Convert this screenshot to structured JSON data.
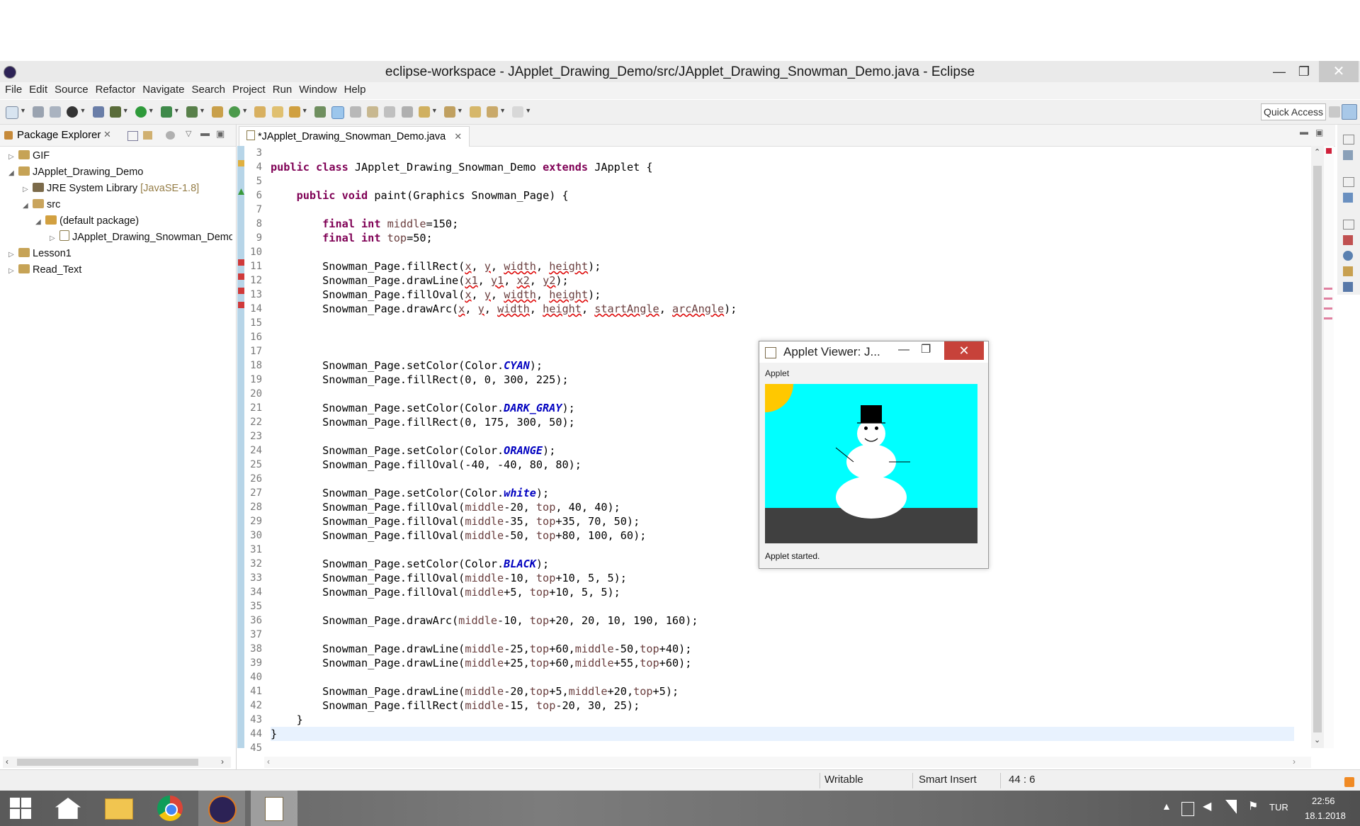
{
  "window": {
    "title": "eclipse-workspace - JApplet_Drawing_Demo/src/JApplet_Drawing_Snowman_Demo.java - Eclipse"
  },
  "menu": [
    "File",
    "Edit",
    "Source",
    "Refactor",
    "Navigate",
    "Search",
    "Project",
    "Run",
    "Window",
    "Help"
  ],
  "toolbar": {
    "quick_access": "Quick Access"
  },
  "package_explorer": {
    "tab_label": "Package Explorer",
    "items": [
      {
        "label": "GIF"
      },
      {
        "label": "JApplet_Drawing_Demo"
      },
      {
        "label": "JRE System Library",
        "decoration": "[JavaSE-1.8]"
      },
      {
        "label": "src"
      },
      {
        "label": "(default package)"
      },
      {
        "label": "JApplet_Drawing_Snowman_Demo"
      },
      {
        "label": "Lesson1"
      },
      {
        "label": "Read_Text"
      }
    ]
  },
  "editor": {
    "tab_label": "*JApplet_Drawing_Snowman_Demo.java",
    "line_numbers": [
      "3",
      "4",
      "5",
      "6",
      "7",
      "8",
      "9",
      "10",
      "11",
      "12",
      "13",
      "14",
      "15",
      "16",
      "17",
      "18",
      "19",
      "20",
      "21",
      "22",
      "23",
      "24",
      "25",
      "26",
      "27",
      "28",
      "29",
      "30",
      "31",
      "32",
      "33",
      "34",
      "35",
      "36",
      "37",
      "38",
      "39",
      "40",
      "41",
      "42",
      "43",
      "44",
      "45"
    ],
    "lines": [
      "",
      "public class JApplet_Drawing_Snowman_Demo extends JApplet {",
      "",
      "    public void paint(Graphics Snowman_Page) {",
      "",
      "        final int middle=150;",
      "        final int top=50;",
      "",
      "        Snowman_Page.fillRect(x, y, width, height);",
      "        Snowman_Page.drawLine(x1, y1, x2, y2);",
      "        Snowman_Page.fillOval(x, y, width, height);",
      "        Snowman_Page.drawArc(x, y, width, height, startAngle, arcAngle);",
      "",
      "",
      "",
      "        Snowman_Page.setColor(Color.CYAN);",
      "        Snowman_Page.fillRect(0, 0, 300, 225);",
      "",
      "        Snowman_Page.setColor(Color.DARK_GRAY);",
      "        Snowman_Page.fillRect(0, 175, 300, 50);",
      "",
      "        Snowman_Page.setColor(Color.ORANGE);",
      "        Snowman_Page.fillOval(-40, -40, 80, 80);",
      "",
      "        Snowman_Page.setColor(Color.white);",
      "        Snowman_Page.fillOval(middle-20, top, 40, 40);",
      "        Snowman_Page.fillOval(middle-35, top+35, 70, 50);",
      "        Snowman_Page.fillOval(middle-50, top+80, 100, 60);",
      "",
      "        Snowman_Page.setColor(Color.BLACK);",
      "        Snowman_Page.fillOval(middle-10, top+10, 5, 5);",
      "        Snowman_Page.fillOval(middle+5, top+10, 5, 5);",
      "",
      "        Snowman_Page.drawArc(middle-10, top+20, 20, 10, 190, 160);",
      "",
      "        Snowman_Page.drawLine(middle-25,top+60,middle-50,top+40);",
      "        Snowman_Page.drawLine(middle+25,top+60,middle+55,top+60);",
      "",
      "        Snowman_Page.drawLine(middle-20,top+5,middle+20,top+5);",
      "        Snowman_Page.fillRect(middle-15, top-20, 30, 25);",
      "    }",
      "}",
      ""
    ],
    "current_line": "44"
  },
  "applet_viewer": {
    "title": "Applet Viewer: J...",
    "menu_label": "Applet",
    "status": "Applet started."
  },
  "status_bar": {
    "mode": "Writable",
    "insert": "Smart Insert",
    "position": "44 : 6"
  },
  "taskbar": {
    "lang": "TUR",
    "time": "22:56",
    "date": "18.1.2018"
  },
  "colors": {
    "cyan": "#00ffff",
    "dark_gray": "#404040",
    "orange": "#ffc800",
    "white": "#ffffff",
    "black": "#000000",
    "keyword": "#7f0055",
    "field": "#0000c0"
  }
}
